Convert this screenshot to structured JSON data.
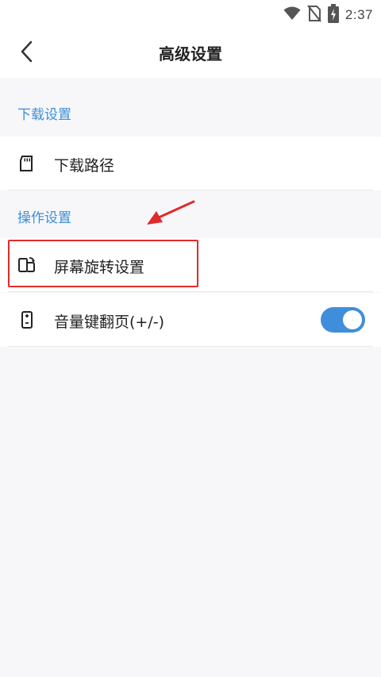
{
  "status_bar": {
    "time": "2:37",
    "icons": [
      "wifi-icon",
      "no-sim-icon",
      "battery-charging-icon"
    ]
  },
  "header": {
    "title": "高级设置",
    "back_icon": "chevron-left-icon"
  },
  "sections": [
    {
      "title": "下载设置",
      "items": [
        {
          "label": "下载路径",
          "icon": "sd-card-icon"
        }
      ]
    },
    {
      "title": "操作设置",
      "items": [
        {
          "label": "屏幕旋转设置",
          "icon": "screen-rotation-icon"
        },
        {
          "label": "音量键翻页(+/-)",
          "icon": "phone-volume-icon",
          "toggle": true,
          "toggle_on": true
        }
      ]
    }
  ],
  "colors": {
    "accent": "#3f8edb",
    "section_header": "#3d8fd6",
    "annotation": "#e02b2b",
    "background": "#f7f7fa"
  }
}
